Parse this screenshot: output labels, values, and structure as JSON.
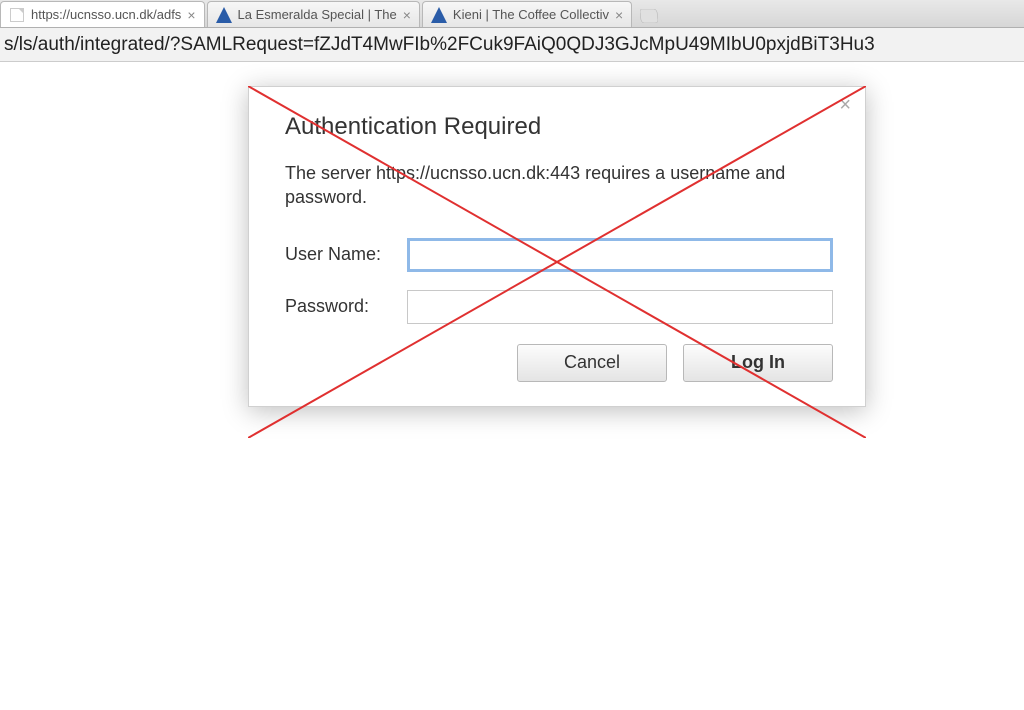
{
  "tabs": [
    {
      "title": "https://ucnsso.ucn.dk/adfs",
      "favicon": "page"
    },
    {
      "title": "La Esmeralda Special | The",
      "favicon": "blue"
    },
    {
      "title": "Kieni | The Coffee Collectiv",
      "favicon": "blue"
    }
  ],
  "address_bar": {
    "url": "s/ls/auth/integrated/?SAMLRequest=fZJdT4MwFIb%2FCuk9FAiQ0QDJ3GJcMpU49MIbU0pxjdBiT3Hu3"
  },
  "dialog": {
    "title": "Authentication Required",
    "message": "The server https://ucnsso.ucn.dk:443 requires a username and password.",
    "username_label": "User Name:",
    "password_label": "Password:",
    "username_value": "",
    "password_value": "",
    "cancel_label": "Cancel",
    "login_label": "Log In"
  },
  "annotation": {
    "type": "red-cross"
  }
}
